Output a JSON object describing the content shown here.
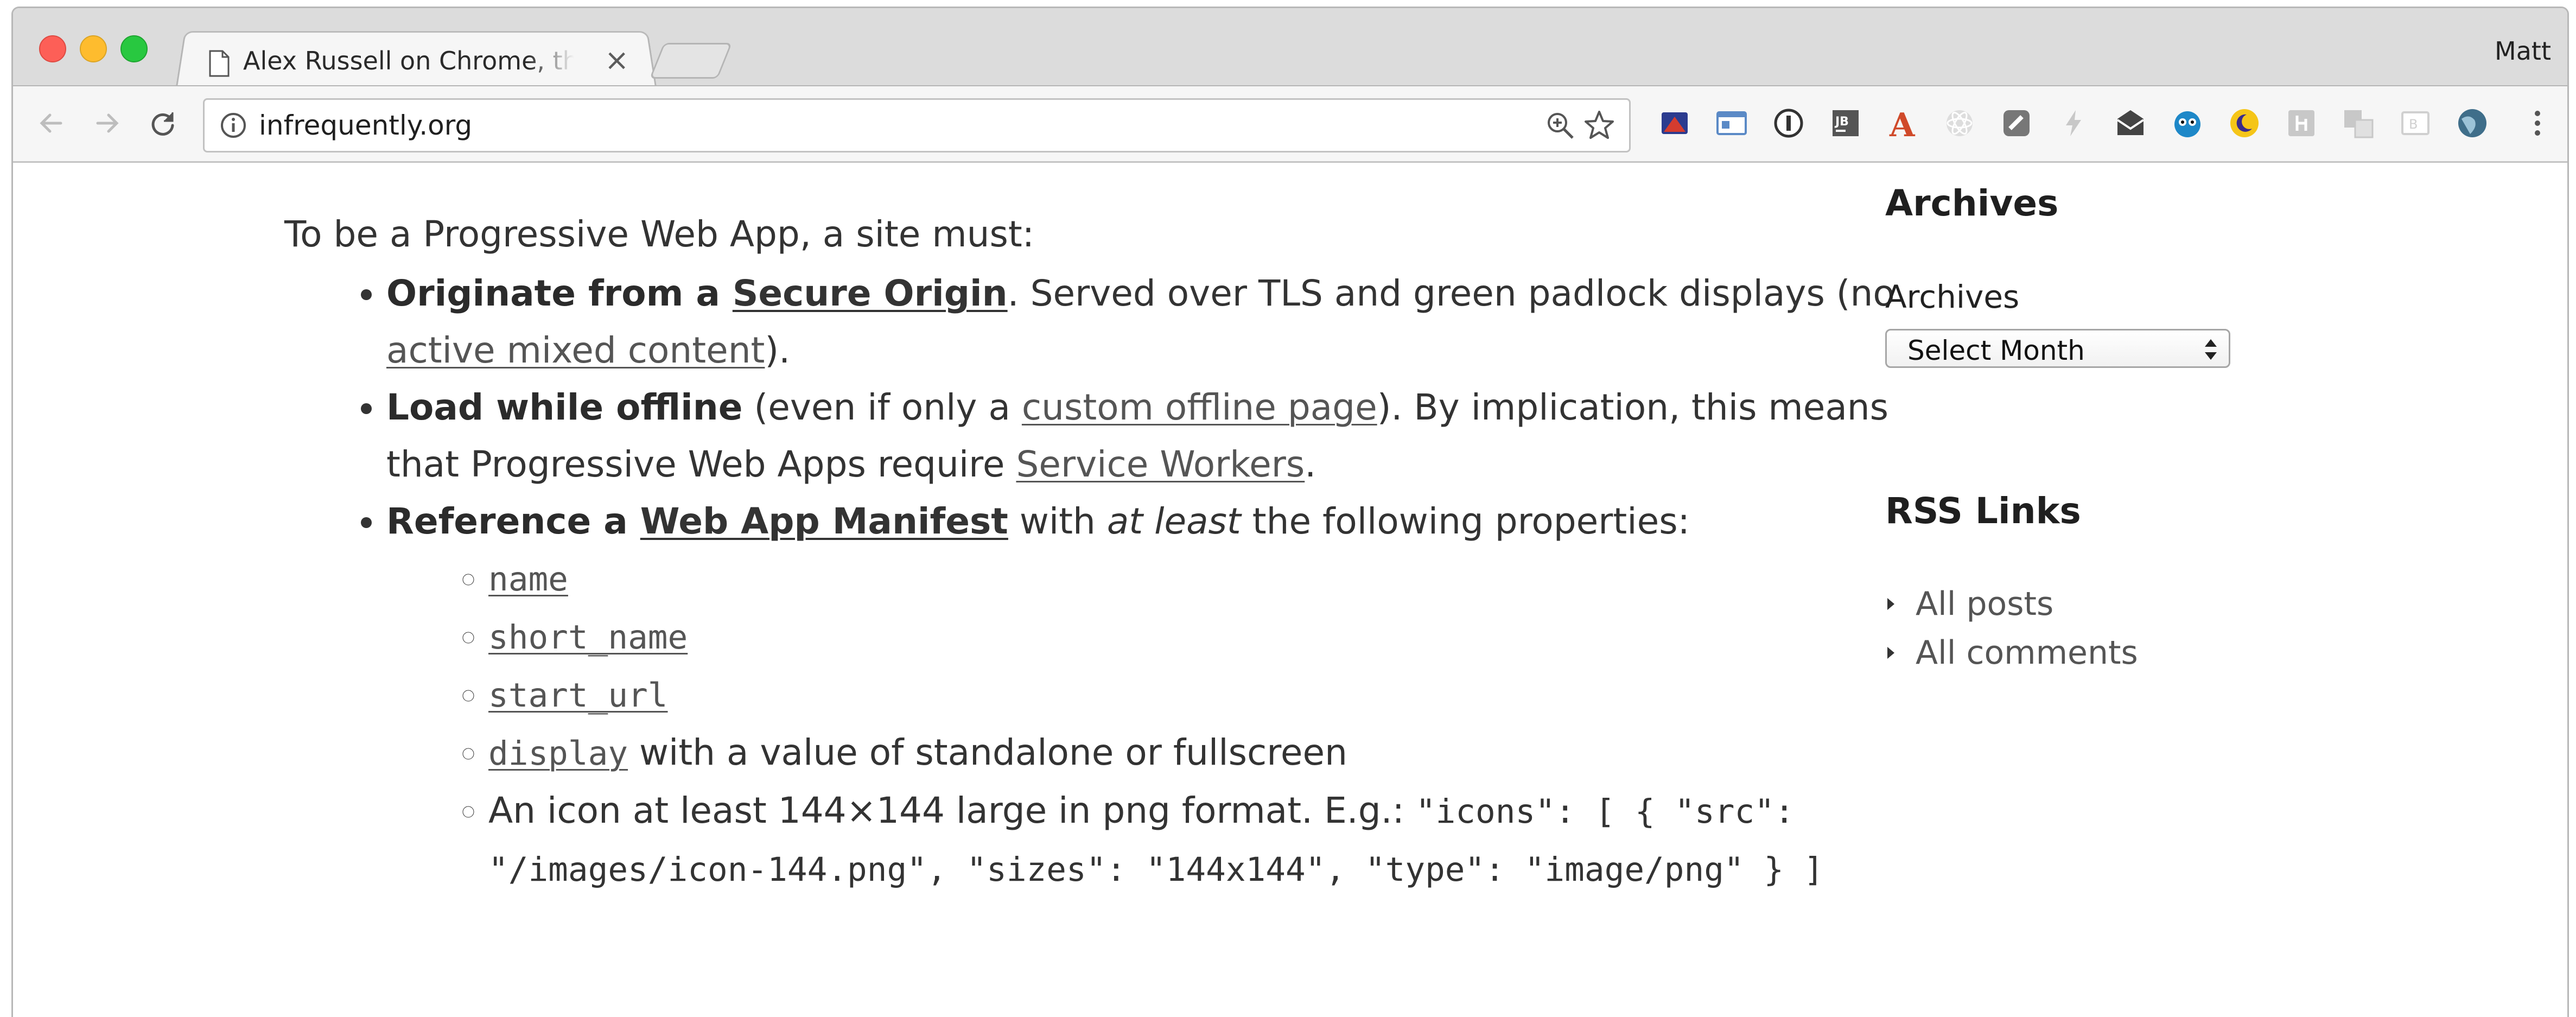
{
  "browser": {
    "tab_title": "Alex Russell on Chrome, the Web Platform & More",
    "tab_close_glyph": "×",
    "profile_name": "Matt",
    "url": "infrequently.org",
    "extensions": [
      "ext-1-icon",
      "ext-2-icon",
      "onepassword-icon",
      "jetbrains-icon",
      "font-a-icon",
      "ext-6-icon",
      "ext-7-icon",
      "bolt-icon",
      "mail-icon",
      "owl-icon",
      "moon-icon",
      "ext-12-icon",
      "translate-icon",
      "ext-14-icon",
      "globe-icon"
    ]
  },
  "article": {
    "intro": "To be a Progressive Web App, a site must:",
    "item1": {
      "bold_prefix": "Originate from a ",
      "bold_link": "Secure Origin",
      "text1": ". Served over TLS and green padlock displays (no ",
      "link": "active mixed content",
      "text2": ")."
    },
    "item2": {
      "bold": "Load while offline",
      "text1": " (even if only a ",
      "link": "custom offline page",
      "text2": "). By implication, this means that Progressive Web Apps require ",
      "link2": "Service Workers",
      "text3": "."
    },
    "item3": {
      "bold_prefix": "Reference a ",
      "bold_link": "Web App Manifest",
      "text1": " with ",
      "italic": "at least",
      "text2": " the following properties:"
    },
    "props": {
      "name": "name",
      "short_name": "short_name",
      "start_url": "start_url",
      "display": "display",
      "display_suffix": " with a value of standalone or fullscreen",
      "icon_text": "An icon at least 144×144 large in png format. E.g.: ",
      "icon_code": "\"icons\": [ { \"src\": \"/images/icon-144.png\", \"sizes\": \"144x144\", \"type\": \"image/png\" } ]"
    }
  },
  "sidebar": {
    "archives_heading": "Archives",
    "archives_label": "Archives",
    "archives_select": "Select Month",
    "rss_heading": "RSS Links",
    "rss_links": [
      "All posts",
      "All comments"
    ]
  },
  "colors": {
    "text": "#333333",
    "link": "#555555",
    "tabbar": "#dcdcdc",
    "toolbar": "#f6f6f6"
  }
}
